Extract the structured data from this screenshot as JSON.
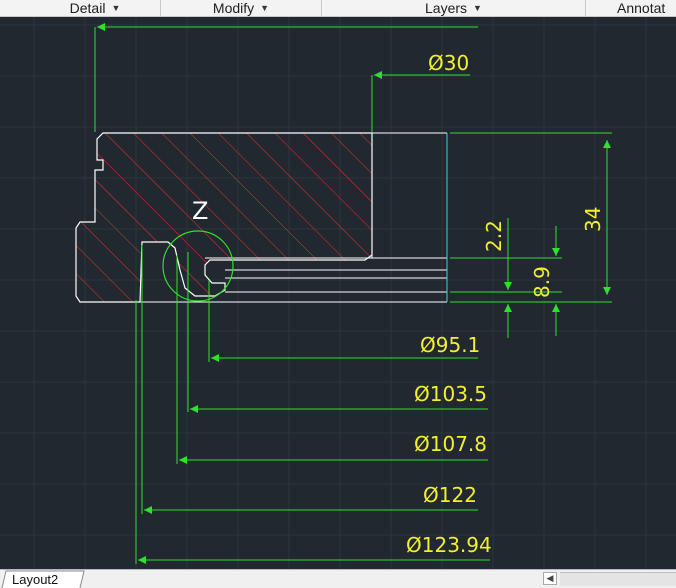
{
  "ribbon": {
    "panels": [
      {
        "label": "Detail"
      },
      {
        "label": "Modify"
      },
      {
        "label": "Layers"
      },
      {
        "label": "Annotat"
      }
    ]
  },
  "drawing": {
    "section_label": "Z",
    "dimensions": {
      "d30": "Ø30",
      "d95_1": "Ø95.1",
      "d103_5": "Ø103.5",
      "d107_8": "Ø107.8",
      "d122": "Ø122",
      "d123_94": "Ø123.94",
      "h34": "34",
      "h2_2": "2.2",
      "h8_9": "8.9"
    },
    "colors": {
      "background": "#212830",
      "dimension_lines": "#2fe02f",
      "dimension_text": "#f2ef2f",
      "hatch": "#e83030",
      "outline": "#ffffff",
      "detail_circle": "#2fe02f"
    }
  },
  "statusbar": {
    "layout_tab": "Layout2",
    "scroll_left_icon": "scroll-left-arrow"
  }
}
